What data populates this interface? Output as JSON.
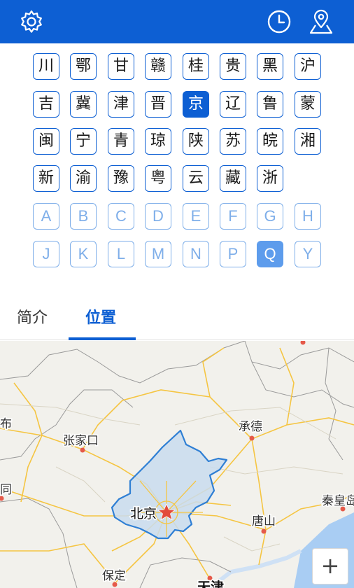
{
  "toolbar": {
    "settings_icon": "gear-icon",
    "history_icon": "clock-icon",
    "location_icon": "map-pin-icon"
  },
  "province_keys": [
    [
      "川",
      "鄂",
      "甘",
      "赣",
      "桂",
      "贵",
      "黑",
      "沪"
    ],
    [
      "吉",
      "冀",
      "津",
      "晋",
      "京",
      "辽",
      "鲁",
      "蒙"
    ],
    [
      "闽",
      "宁",
      "青",
      "琼",
      "陕",
      "苏",
      "皖",
      "湘"
    ],
    [
      "新",
      "渝",
      "豫",
      "粤",
      "云",
      "藏",
      "浙"
    ]
  ],
  "selected_province": "京",
  "letter_keys": [
    [
      "A",
      "B",
      "C",
      "D",
      "E",
      "F",
      "G",
      "H"
    ],
    [
      "J",
      "K",
      "L",
      "M",
      "N",
      "P",
      "Q",
      "Y"
    ]
  ],
  "selected_letter": "Q",
  "tabs": [
    {
      "label": "简介",
      "active": false
    },
    {
      "label": "位置",
      "active": true
    }
  ],
  "map": {
    "labels": {
      "beijing": "北京",
      "chengde": "承德",
      "zhangjiakou": "张家口",
      "tangshan": "唐山",
      "qinhuangdao": "秦皇岛",
      "baoding": "保定",
      "tianjin": "天津",
      "left_bu": "布",
      "left_tong": "同"
    },
    "zoom_in_label": "+"
  }
}
